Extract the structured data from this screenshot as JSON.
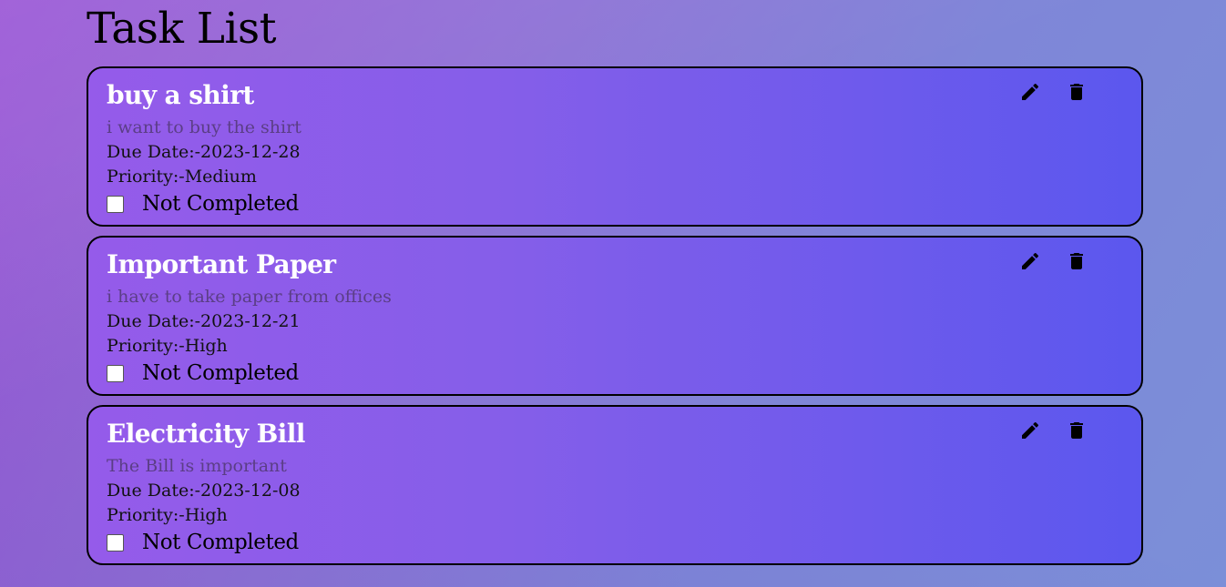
{
  "page": {
    "title": "Task List"
  },
  "icons": {
    "edit": "pencil-icon",
    "delete": "trash-icon"
  },
  "colors": {
    "card_gradient_start": "#955bea",
    "card_gradient_end": "#5b57ee",
    "title_text": "#ffffff",
    "description_text": "#5b3e86"
  },
  "tasks": [
    {
      "title": "buy a shirt",
      "description": "i want to buy the shirt",
      "due": "Due Date:-2023-12-28",
      "priority": "Priority:-Medium",
      "status": "Not Completed",
      "completed": false
    },
    {
      "title": "Important Paper",
      "description": "i have to take paper from offices",
      "due": "Due Date:-2023-12-21",
      "priority": "Priority:-High",
      "status": "Not Completed",
      "completed": false
    },
    {
      "title": "Electricity Bill",
      "description": "The Bill is important",
      "due": "Due Date:-2023-12-08",
      "priority": "Priority:-High",
      "status": "Not Completed",
      "completed": false
    }
  ]
}
